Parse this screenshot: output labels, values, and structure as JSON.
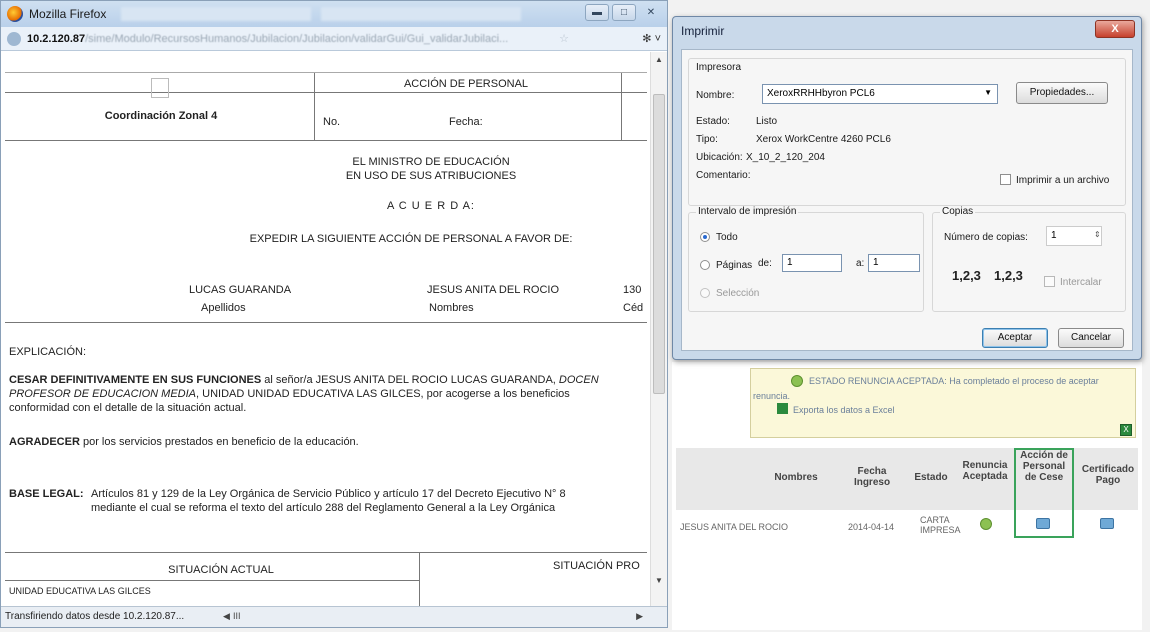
{
  "firefox": {
    "title": "Mozilla Firefox",
    "url_host": "10.2.120.87",
    "url_path": "/sime/Modulo/RecursosHumanos/Jubilacion/Jubilacion/validarGui/Gui_validarJubilaci...",
    "status": "Transfiriendo datos desde 10.2.120.87...",
    "hscroll_grip": "III"
  },
  "doc": {
    "coord": "Coordinación Zonal 4",
    "accion": "ACCIÓN DE PERSONAL",
    "no": "No.",
    "fecha": "Fecha:",
    "ministro": "EL MINISTRO DE EDUCACIÓN",
    "atribuciones": "EN USO DE SUS ATRIBUCIONES",
    "acuerda": "A C U E R D A:",
    "expedir": "EXPEDIR LA SIGUIENTE ACCIÓN DE PERSONAL A FAVOR DE:",
    "apellido_val": "LUCAS GUARANDA",
    "apellido_lbl": "Apellidos",
    "nombre_val": "JESUS ANITA DEL ROCIO",
    "nombre_lbl": "Nombres",
    "cedula_val": "130",
    "cedula_lbl": "Céd",
    "explicacion": "EXPLICACIÓN:",
    "cesar_bold": "CESAR DEFINITIVAMENTE EN SUS FUNCIONES",
    "cesar_rest": " al señor/a JESUS ANITA DEL ROCIO LUCAS GUARANDA, ",
    "cesar_italic": "DOCEN",
    "cesar_line2_italic": "PROFESOR DE EDUCACION MEDIA",
    "cesar_line2_rest": ", UNIDAD UNIDAD EDUCATIVA LAS GILCES, por acogerse a los beneficios",
    "cesar_line3": "conformidad con el detalle de la situación actual.",
    "agradecer_bold": "AGRADECER",
    "agradecer_rest": " por los servicios prestados en beneficio de la educación.",
    "base_legal_lbl": "BASE LEGAL:",
    "base_legal_1": "Artículos 81 y 129 de la Ley Orgánica de Servicio Público y artículo 17 del Decreto Ejecutivo N° 8",
    "base_legal_2": "mediante el cual se reforma el texto del artículo 288 del Reglamento General a la Ley Orgánica",
    "situacion_actual": "SITUACIÓN ACTUAL",
    "situacion_pro": "SITUACIÓN PRO",
    "unidad_cut": "UNIDAD EDUCATIVA LAS GILCES"
  },
  "print": {
    "title": "Imprimir",
    "close": "X",
    "impresora": "Impresora",
    "nombre_lbl": "Nombre:",
    "nombre_val": "XeroxRRHHbyron PCL6",
    "propiedades": "Propiedades...",
    "estado_lbl": "Estado:",
    "estado_val": "Listo",
    "tipo_lbl": "Tipo:",
    "tipo_val": "Xerox WorkCentre 4260 PCL6",
    "ubicacion_lbl": "Ubicación:",
    "ubicacion_val": "X_10_2_120_204",
    "comentario_lbl": "Comentario:",
    "imprimir_archivo": "Imprimir a un archivo",
    "intervalo": "Intervalo de impresión",
    "todo": "Todo",
    "paginas": "Páginas",
    "de_lbl": "de:",
    "de_val": "1",
    "a_lbl": "a:",
    "a_val": "1",
    "seleccion": "Selección",
    "copias": "Copias",
    "num_copias_lbl": "Número de copias:",
    "num_copias_val": "1",
    "intercalar": "Intercalar",
    "collate_a": "1,2,3",
    "collate_b": "1,2,3",
    "aceptar": "Aceptar",
    "cancelar": "Cancelar"
  },
  "app": {
    "notice_1": "ESTADO RENUNCIA ACEPTADA: Ha completado el proceso de aceptar",
    "notice_2": "renuncia.",
    "notice_3": "Exporta los datos a Excel",
    "excel_icon_glyph": "X",
    "headers": {
      "nombres": "Nombres",
      "fecha": "Fecha Ingreso",
      "estado": "Estado",
      "renuncia": "Renuncia Aceptada",
      "accion": "Acción de Personal de Cese",
      "certificado": "Certificado Pago"
    },
    "row": {
      "nombres": "JESUS ANITA DEL ROCIO",
      "fecha": "2014-04-14",
      "estado": "CARTA IMPRESA"
    },
    "highlight_color": "#3aa35b"
  }
}
